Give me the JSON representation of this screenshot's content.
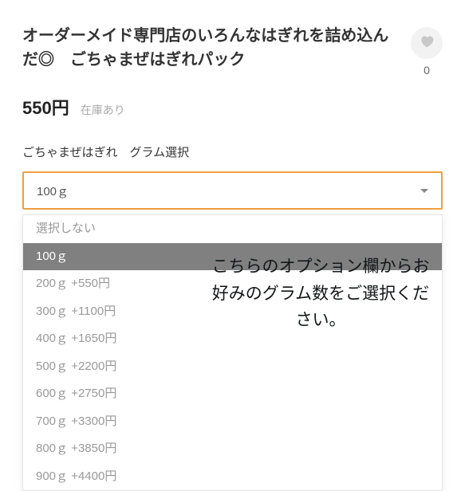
{
  "header": {
    "title": "オーダーメイド専門店のいろんなはぎれを詰め込んだ◎　ごちゃまぜはぎれパック",
    "favorite_count": "0"
  },
  "price": {
    "amount": "550円",
    "stock_label": "在庫あり"
  },
  "option": {
    "label": "ごちゃまぜはぎれ　グラム選択",
    "selected": "100ｇ",
    "items": [
      "選択しない",
      "100ｇ",
      "200ｇ +550円",
      "300ｇ +1100円",
      "400ｇ +1650円",
      "500ｇ +2200円",
      "600ｇ +2750円",
      "700ｇ +3300円",
      "800ｇ +3850円",
      "900ｇ +4400円"
    ]
  },
  "instruction": "こちらのオプション欄からお好みのグラム数をご選択ください。"
}
